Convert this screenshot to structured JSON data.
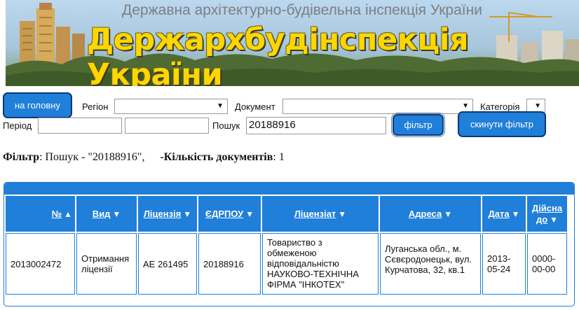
{
  "banner": {
    "subtitle": "Державна архітектурно-будівельна інспекція України",
    "title": "Держархбудінспекція України"
  },
  "filters": {
    "home_button": "на головну",
    "region_label": "Регіон",
    "region_value": "",
    "document_label": "Документ",
    "document_value": "",
    "category_label": "Категорія",
    "category_value": "",
    "period_label": "Період",
    "period_from": "",
    "period_to": "",
    "search_label": "Пошук",
    "search_value": "20188916",
    "filter_button": "фільтр",
    "reset_button": "скинути фільтр"
  },
  "summary": {
    "filter_label": "Фільтр",
    "filter_text": ": Пошук - \"20188916\",",
    "count_label": "-Кількість документів",
    "count_text": ": 1"
  },
  "table": {
    "columns": [
      "№",
      "Вид",
      "Ліцензія",
      "ЄДРПОУ",
      "Ліцензіат",
      "Адреса",
      "Дата",
      "Дійсна до"
    ],
    "rows": [
      {
        "number": "2013002472",
        "type": "Отримання ліцензії",
        "license": "АЕ 261495",
        "edrpou": "20188916",
        "licensee": "Товариство з обмеженою відповідальністю НАУКОВО-ТЕХНІЧНА ФІРМА \"ІНКОТЕХ\"",
        "address": "Луганська обл., м. Сєвєродонецьк, вул. Курчатова, 32, кв.1",
        "date": "2013-05-24",
        "valid_until": "0000-00-00"
      }
    ]
  },
  "colors": {
    "accent": "#1f7fd9",
    "button_border": "#0a3a7a",
    "title_yellow": "#ffd600"
  },
  "icons": {
    "sort_asc": "triangle-up-icon",
    "sort_desc": "triangle-down-icon",
    "select_arrow": "chevron-down-icon"
  }
}
